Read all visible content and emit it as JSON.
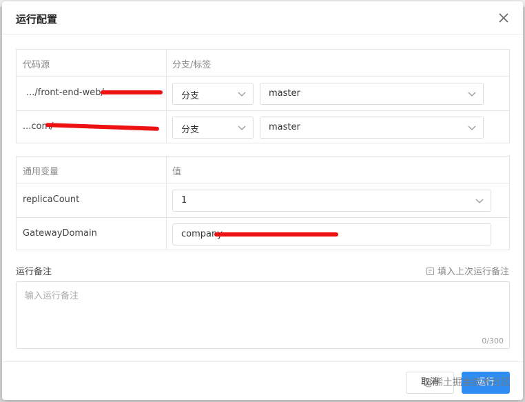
{
  "modal": {
    "title": "运行配置"
  },
  "code_table": {
    "headers": [
      "代码源",
      "分支/标签"
    ],
    "rows": [
      {
        "source": ".../front-end-web/",
        "ref_type": "分支",
        "ref_value": "master"
      },
      {
        "source": "...com/",
        "ref_type": "分支",
        "ref_value": "master"
      }
    ]
  },
  "var_table": {
    "headers": [
      "通用变量",
      "值"
    ],
    "rows": [
      {
        "name": "replicaCount",
        "value": "1",
        "kind": "select"
      },
      {
        "name": "GatewayDomain",
        "value": "company.",
        "kind": "input"
      }
    ]
  },
  "notes": {
    "label": "运行备注",
    "fill_last_label": "填入上次运行备注",
    "placeholder": "输入运行备注",
    "counter": "0/300"
  },
  "footer": {
    "cancel_label": "取消",
    "run_label": "运行"
  },
  "watermark": "@稀土掘金技术社区",
  "colors": {
    "primary": "#2f8cf0",
    "redaction": "#ee1111"
  }
}
